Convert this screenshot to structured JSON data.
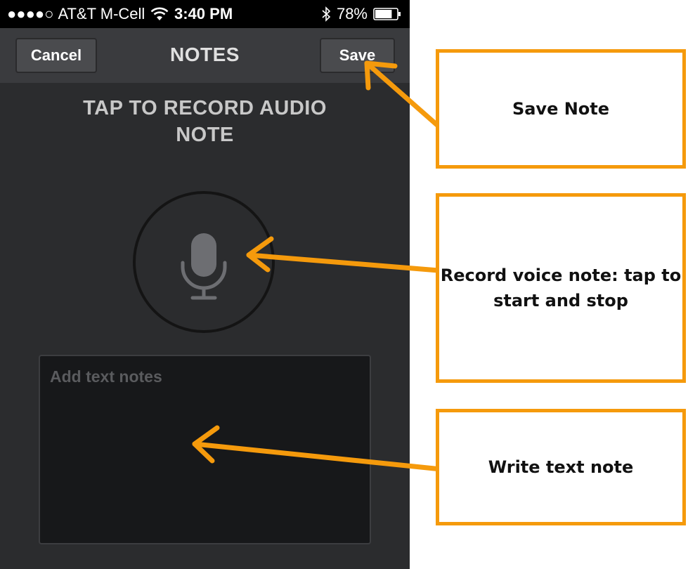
{
  "status_bar": {
    "signal_dots": "●●●●○",
    "carrier": "AT&T M-Cell",
    "time": "3:40 PM",
    "battery_percent": "78%",
    "battery_level": 0.78,
    "icons": [
      "signal-icon",
      "wifi-icon",
      "bluetooth-icon",
      "battery-icon"
    ]
  },
  "nav": {
    "cancel_label": "Cancel",
    "title": "NOTES",
    "save_label": "Save"
  },
  "recorder": {
    "instruction": "TAP TO RECORD AUDIO NOTE",
    "icon": "microphone-icon"
  },
  "text_notes": {
    "placeholder": "Add text notes",
    "value": ""
  },
  "annotations": {
    "save": "Save Note",
    "record": "Record voice note: tap to start and stop",
    "write": "Write text note",
    "color": "#f59a0c"
  },
  "colors": {
    "screen_bg": "#2b2c2e",
    "navbar_bg": "#3a3b3e",
    "status_bg": "#000000",
    "accent": "#f59a0c"
  }
}
